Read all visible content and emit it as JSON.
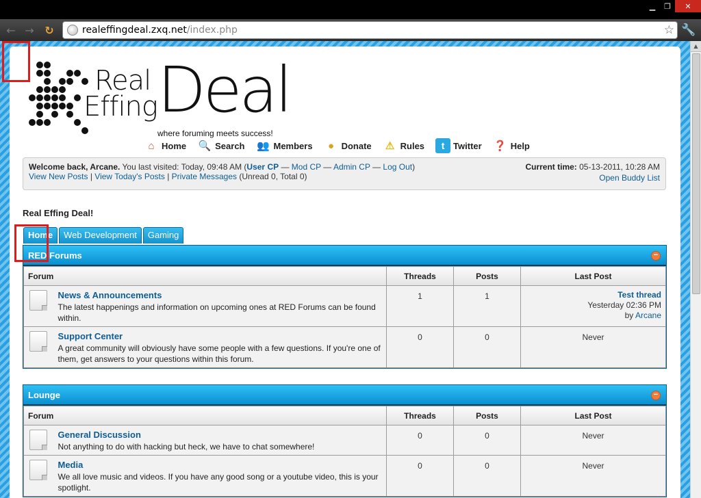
{
  "browser": {
    "url_host": "realeffingdeal.zxq.net",
    "url_path": "/index.php",
    "icons": [
      "back-icon",
      "forward-icon",
      "reload-icon",
      "globe-icon",
      "star-icon",
      "wrench-icon",
      "minimize-icon",
      "maximize-icon",
      "close-icon"
    ]
  },
  "logo": {
    "word_real": "Real",
    "word_effing": "Effing",
    "word_deal": "Deal",
    "tagline": "where foruming meets success!"
  },
  "menu": {
    "home": "Home",
    "search": "Search",
    "members": "Members",
    "donate": "Donate",
    "rules": "Rules",
    "twitter": "Twitter",
    "help": "Help"
  },
  "welcome": {
    "greeting": "Welcome back, Arcane.",
    "last_visited": " You last visited: Today, 09:48 AM (",
    "user_cp": "User CP",
    "sep": " — ",
    "mod_cp": "Mod CP",
    "admin_cp": "Admin CP",
    "log_out": "Log Out",
    "close_paren": ")",
    "view_new_posts": "View New Posts",
    "pipe": " | ",
    "view_todays_posts": "View Today's Posts",
    "private_messages": "Private Messages",
    "unread": " (Unread 0, Total 0)",
    "current_time_label": "Current time:",
    "current_time_value": " 05-13-2011, 10:28 AM",
    "open_buddy_list": "Open Buddy List"
  },
  "board_title": "Real Effing Deal!",
  "tabs": [
    "Home",
    "Web Development",
    "Gaming"
  ],
  "columns": {
    "forum": "Forum",
    "threads": "Threads",
    "posts": "Posts",
    "last_post": "Last Post"
  },
  "categories": [
    {
      "title": "RED Forums",
      "forums": [
        {
          "name": "News & Announcements",
          "description": "The latest happenings and information on upcoming ones at RED Forums can be found within.",
          "threads": "1",
          "posts": "1",
          "last_post": {
            "thread": "Test thread",
            "time": "Yesterday 02:36 PM",
            "by_label": "by ",
            "author": "Arcane"
          }
        },
        {
          "name": "Support Center",
          "description": "A great community will obviously have some people with a few questions. If you're one of them, get answers to your questions within this forum.",
          "threads": "0",
          "posts": "0",
          "last_post_text": "Never"
        }
      ]
    },
    {
      "title": "Lounge",
      "forums": [
        {
          "name": "General Discussion",
          "description": "Not anything to do with hacking but heck, we have to chat somewhere!",
          "threads": "0",
          "posts": "0",
          "last_post_text": "Never"
        },
        {
          "name": "Media",
          "description": "We all love music and videos. If you have any good song or a youtube video, this is your spotlight.",
          "threads": "0",
          "posts": "0",
          "last_post_text": "Never"
        }
      ]
    }
  ],
  "colors": {
    "accent": "#1592cd",
    "link": "#0f5d94",
    "annotation": "#e21a1a"
  }
}
